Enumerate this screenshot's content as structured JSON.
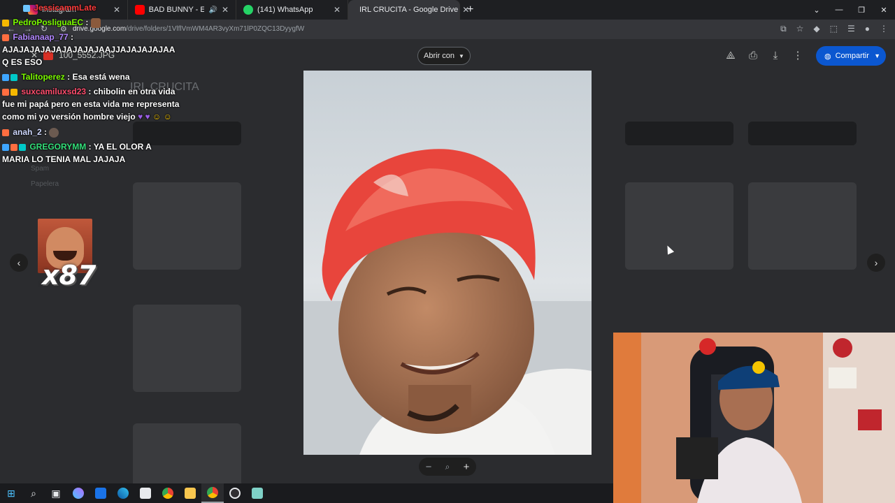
{
  "tabs": [
    {
      "title": "Instagram",
      "active": false
    },
    {
      "title": "BAD BUNNY - EL CLuB (Vis",
      "active": false,
      "audio": true
    },
    {
      "title": "(141) WhatsApp",
      "active": false
    },
    {
      "title": "IRL CRUCITA - Google Drive",
      "active": true
    }
  ],
  "address": {
    "host": "drive.google.com",
    "path": "/drive/folders/1VlflVmWM4AR3vyXm71lP0ZQC13DyygfW"
  },
  "drive": {
    "folder_title": "IRL CRUCITA",
    "sidebar_items": [
      "Spam",
      "Papelera"
    ]
  },
  "viewer": {
    "filename": "100_5552.JPG",
    "open_with_label": "Abrir con",
    "share_label": "Compartir"
  },
  "chat": [
    {
      "user": "JessicammLate",
      "text": "",
      "color": "#ff3b3b"
    },
    {
      "user": "PedroPosliguaEC",
      "text": "",
      "color": "#7cfc00"
    },
    {
      "user": "Fabianaap_77",
      "text": "",
      "color": "#b388ff"
    },
    {
      "user": "",
      "text": "AJAJAJAJAJAJAJAJAJAAJJAJAJAJAJAA Q ES ESO",
      "color": "#ffffff"
    },
    {
      "user": "Talitoperez",
      "text": "Esa está wena",
      "color": "#7cfc00"
    },
    {
      "user": "suxcamiluxsd23",
      "text": "chibolin en otra vida fue mi papá pero en esta vida me representa como mi yo versión hombre viejo",
      "color": "#ff4d6d"
    },
    {
      "user": "anah_2",
      "text": "",
      "color": "#cfd8ff"
    },
    {
      "user": "GREGORYMM",
      "text": "YA EL OLOR A MARIA LO TENIA MAL JAJAJA",
      "color": "#33e07a"
    }
  ],
  "emote_combo": "x87",
  "taskbar_icons": [
    "start-icon",
    "search-icon",
    "task-view-icon",
    "copilot-icon",
    "mail-icon",
    "edge-icon",
    "store-icon",
    "chrome-icon",
    "explorer-icon",
    "chrome-active-icon",
    "obs-icon",
    "notes-icon"
  ]
}
